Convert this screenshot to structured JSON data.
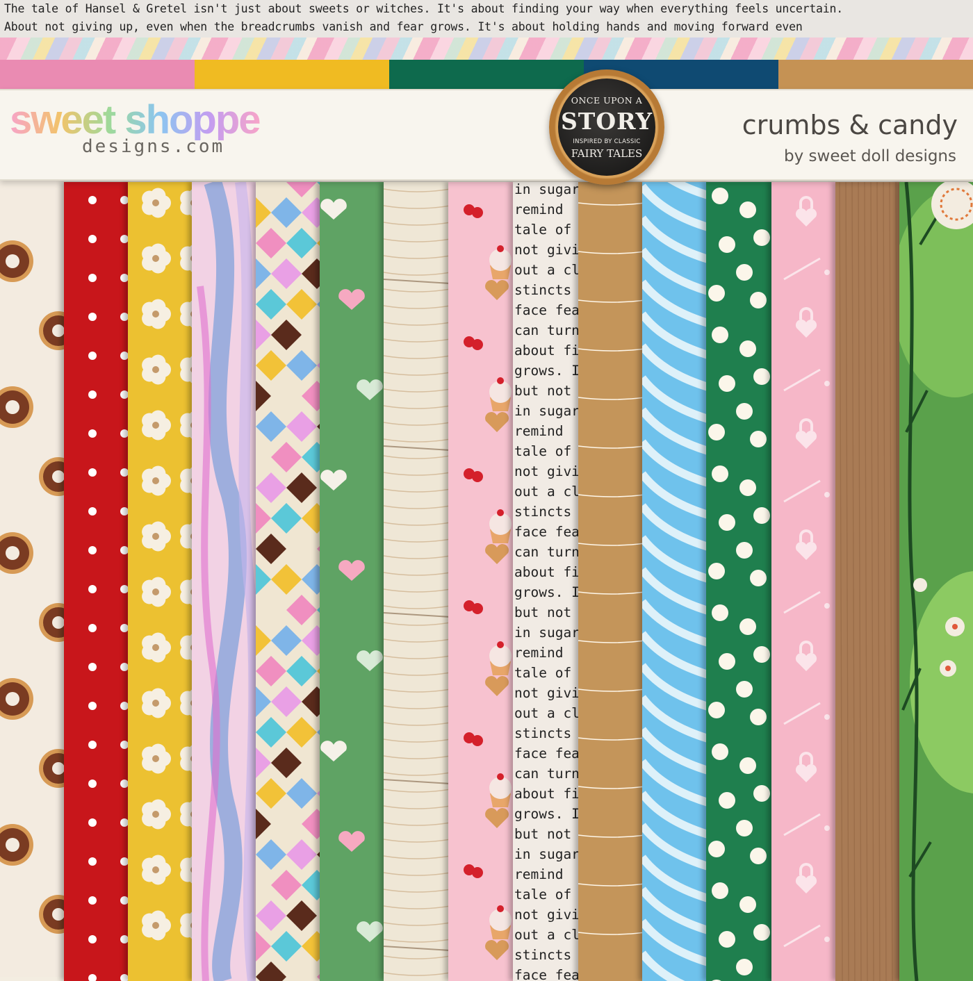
{
  "quote": {
    "line1": "The tale of Hansel & Gretel isn't just about sweets or witches. It's about finding your way when everything feels uncertain.",
    "line2": "About not giving up, even when the breadcrumbs vanish and fear grows. It's about holding hands and moving forward even"
  },
  "color_bars": [
    "#ea8bb2",
    "#f0bb22",
    "#0e6a4d",
    "#0f4a72",
    "#c59254"
  ],
  "logo": {
    "main": "sweet shoppe",
    "sub": "designs.com"
  },
  "badge": {
    "line1": "ONCE UPON A",
    "line2": "STORY",
    "line3": "INSPIRED BY CLASSIC",
    "line4": "FAIRY TALES"
  },
  "kit": {
    "title": "crumbs & candy",
    "byline": "by sweet doll designs"
  },
  "text_paper_words": [
    "in sugar",
    "remind",
    "tale of t",
    "not givin",
    "out a cla",
    "stincts a",
    "face fea",
    "can turn",
    "about fi",
    "grows. I",
    "but not e"
  ],
  "papers": [
    {
      "name": "donut-paper",
      "color": "#f3ebe0"
    },
    {
      "name": "red-polka-dot-paper",
      "color": "#c8161b"
    },
    {
      "name": "yellow-floral-paper",
      "color": "#ecc131"
    },
    {
      "name": "watercolor-wave-paper",
      "color": "#f2d2e4"
    },
    {
      "name": "harlequin-diamond-paper",
      "color": "#f0e6d2"
    },
    {
      "name": "green-heart-paper",
      "color": "#5fa364"
    },
    {
      "name": "whitewashed-wood-paper",
      "color": "#efe7d6"
    },
    {
      "name": "cupcake-cherry-paper",
      "color": "#f7c2cf"
    },
    {
      "name": "text-paper",
      "color": "#f1ebe4"
    },
    {
      "name": "kraft-stitch-paper",
      "color": "#c4955a"
    },
    {
      "name": "blue-wave-paper",
      "color": "#6fc2ec"
    },
    {
      "name": "green-dot-paper",
      "color": "#1f7f4e"
    },
    {
      "name": "pink-lock-key-paper",
      "color": "#f6b7c8"
    },
    {
      "name": "brown-wood-paper",
      "color": "#a97b55"
    },
    {
      "name": "green-forest-paper",
      "color": "#5aa14b"
    }
  ]
}
